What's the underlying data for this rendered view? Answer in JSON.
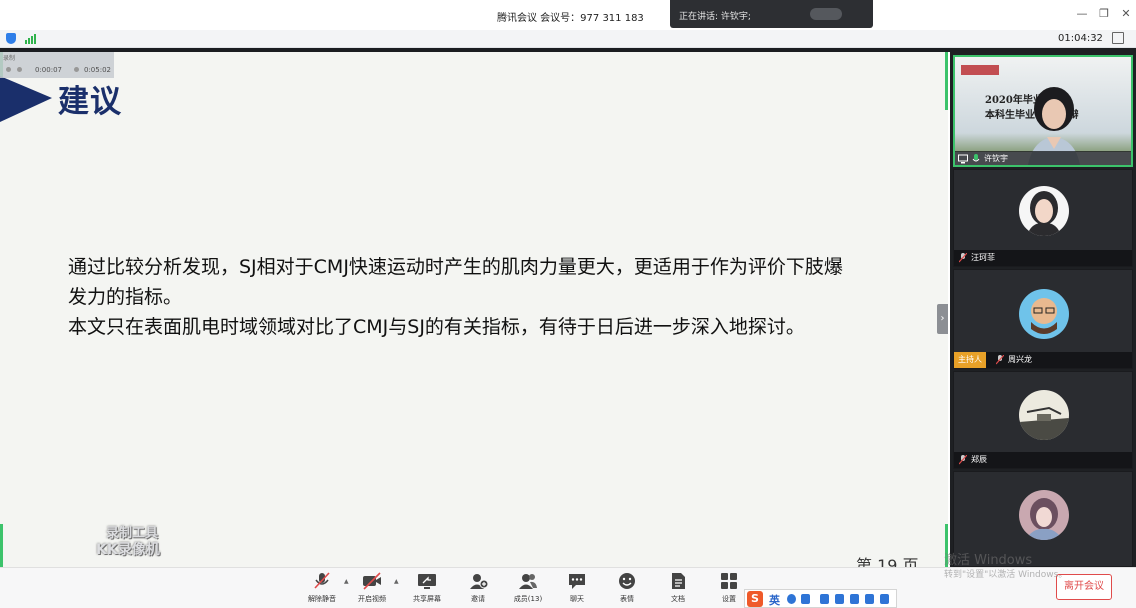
{
  "titlebar": {
    "title": "腾讯会议  会议号：977 311 183",
    "speaking_label": "正在讲话: 许钦宇;"
  },
  "infobar": {
    "timer": "01:04:32"
  },
  "recorder": {
    "label": "录制",
    "elapsed": "0:00:07",
    "total": "0:05:02",
    "watermark_line1": "录制工具",
    "watermark_line2": "KK录像机"
  },
  "slide": {
    "heading": "建议",
    "paragraph_1": "通过比较分析发现，SJ相对于CMJ快速运动时产生的肌肉力量更大，更适用于作为评价下肢爆发力的指标。",
    "paragraph_2": "本文只在表面肌电时域领域对比了CMJ与SJ的有关指标，有待于日后进一步深入地探讨。",
    "page_number": "第 19 页"
  },
  "participants": {
    "active_video": {
      "name": "许钦宇",
      "poster_line1": "2020年毕业 大学",
      "poster_line2": "本科生毕业 线上答辩"
    },
    "tiles": [
      {
        "name": "汪珂菲",
        "host": false
      },
      {
        "name": "周兴龙",
        "host": true,
        "host_label": "主持人"
      },
      {
        "name": "郑辰",
        "host": false
      },
      {
        "name": "",
        "host": false
      }
    ]
  },
  "toolbar": {
    "items": [
      {
        "label": "解除静音",
        "icon": "muted-mic-icon"
      },
      {
        "label": "开启视频",
        "icon": "video-off-icon"
      },
      {
        "label": "共享屏幕",
        "icon": "share-screen-icon"
      },
      {
        "label": "邀请",
        "icon": "invite-icon"
      },
      {
        "label": "成员(13)",
        "icon": "members-icon"
      },
      {
        "label": "聊天",
        "icon": "chat-icon"
      },
      {
        "label": "表情",
        "icon": "emoji-icon"
      },
      {
        "label": "文档",
        "icon": "document-icon"
      },
      {
        "label": "设置",
        "icon": "settings-icon"
      }
    ],
    "leave_label": "离开会议"
  },
  "system": {
    "activate_title": "激活 Windows",
    "activate_subtitle": "转到\"设置\"以激活 Windows。",
    "ime_lang": "英"
  },
  "colors": {
    "accent_green": "#3cc36b",
    "heading_navy": "#1a2f6b",
    "leave_red": "#e04b4b",
    "host_orange": "#e8a128"
  }
}
